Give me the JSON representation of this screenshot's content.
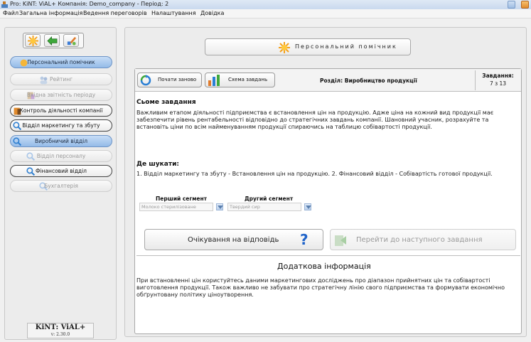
{
  "window": {
    "title": "Pro: KiNT: ViAL+    Компанія: Demo_company - Період: 2"
  },
  "menu": {
    "items": [
      "Файл",
      "Загальна інформація",
      "Ведення переговорів",
      "Налаштування",
      "Довідка"
    ]
  },
  "sidebar": {
    "items": [
      {
        "label": "Персональний помічник",
        "state": "active",
        "icon": "sun-icon"
      },
      {
        "label": "Рейтинг",
        "state": "disabled",
        "icon": "people-icon"
      },
      {
        "label": "Вхідна звітність періоду",
        "state": "disabled",
        "icon": "report-icon"
      },
      {
        "label": "Контроль діяльності компанії",
        "state": "normal",
        "icon": "notebook-icon"
      },
      {
        "label": "Відділ маркетингу та збуту",
        "state": "normal",
        "icon": "magnifier-icon"
      },
      {
        "label": "Виробничий відділ",
        "state": "active",
        "icon": "magnifier-icon"
      },
      {
        "label": "Відділ персоналу",
        "state": "disabled",
        "icon": "magnifier-icon"
      },
      {
        "label": "Фінансовий відділ",
        "state": "normal",
        "icon": "magnifier-icon"
      },
      {
        "label": "Бухгалтерія",
        "state": "disabled",
        "icon": "magnifier-icon"
      }
    ],
    "logo": {
      "name": "KiNT: ViAL+",
      "version": "v: 2.30.0"
    }
  },
  "header": {
    "title": "Персональний помічник"
  },
  "task": {
    "restart_label": "Почати заново",
    "scheme_label": "Схема завдань",
    "section": "Розділ: Виробництво продукції",
    "tasks_title": "Завдання:",
    "tasks_count": "7 з 13",
    "today_title": "Сьоме завдання",
    "today_text": "Важливим етапом діяльності підприємства є встановлення цін на продукцію. Адже ціна на кожний вид продукції має забезпечити рівень рентабельності відповідно до стратегічних завдань компанії. Шановний учасник, розрахуйте та встановіть ціни по всім найменуванням продукції спираючись на таблицю собівартості продукції.",
    "where_title": "Де шукати:",
    "where_text": "1. Відділ маркетингу та збуту - Встановлення цін на продукцію. 2. Фінансовий відділ - Собівартість готової продукції.",
    "segment1_label": "Перший сегмент",
    "segment1_value": "Молоко стерилізоване",
    "segment2_label": "Другий сегмент",
    "segment2_value": "Твердий сир",
    "wait_label": "Очікування на відповідь",
    "wait_symbol": "?",
    "next_label": "Перейти до наступного завдання",
    "extra_title": "Додаткова інформація",
    "extra_text": "При встановленні цін користуйтесь даними маркетингових досліджень про діапазон прийнятних цін та собівартості виготовлення продукції. Також важливо не забувати про стратегічну лінію свого підприємства та формувати економічно обґрунтовану політику ціноутворення."
  },
  "colors": {
    "accent": "#94bbe8",
    "question": "#1f63c9",
    "sun": "#f4a11c"
  }
}
